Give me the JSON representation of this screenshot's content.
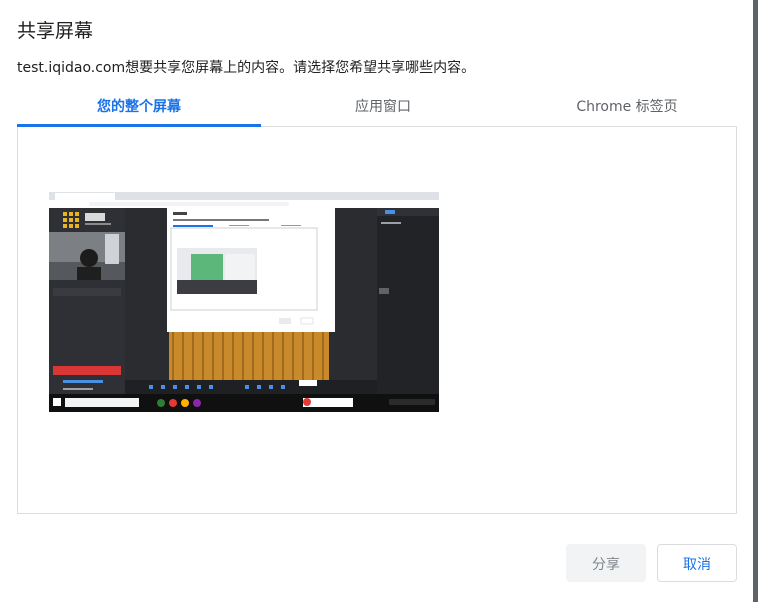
{
  "dialog": {
    "title": "共享屏幕",
    "description": "test.iqidao.com想要共享您屏幕上的内容。请选择您希望共享哪些内容。"
  },
  "tabs": [
    {
      "label": "您的整个屏幕",
      "active": true
    },
    {
      "label": "应用窗口",
      "active": false
    },
    {
      "label": "Chrome 标签页",
      "active": false
    }
  ],
  "buttons": {
    "share_label": "分享",
    "cancel_label": "取消"
  },
  "colors": {
    "accent": "#1a73e8",
    "disabled_text": "#80868b",
    "disabled_bg": "#f1f3f4"
  }
}
